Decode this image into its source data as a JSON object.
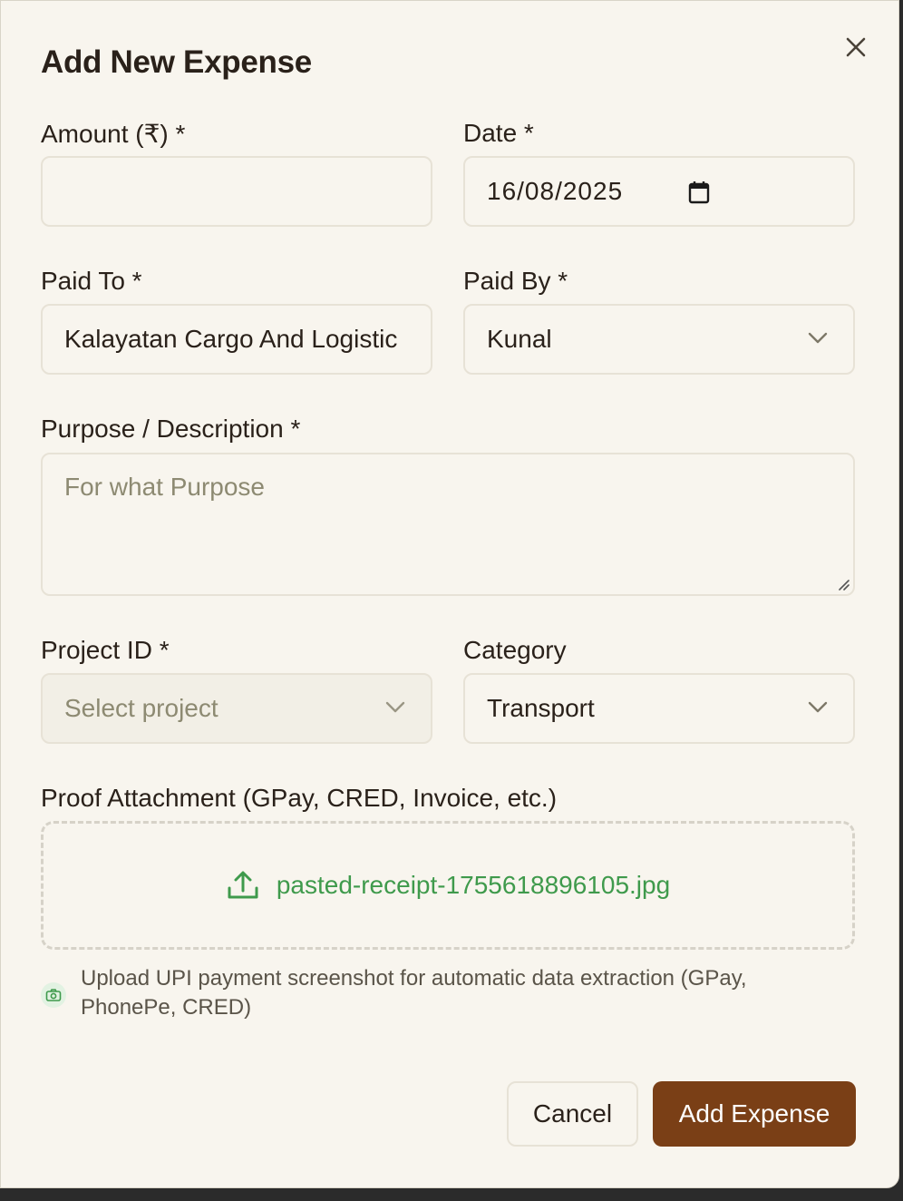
{
  "dialog": {
    "title": "Add New Expense"
  },
  "fields": {
    "amount": {
      "label": "Amount (₹) *",
      "value": ""
    },
    "date": {
      "label": "Date *",
      "value": "16/08/2025"
    },
    "paid_to": {
      "label": "Paid To *",
      "value": "Kalayatan Cargo And Logistic"
    },
    "paid_by": {
      "label": "Paid By *",
      "value": "Kunal"
    },
    "purpose": {
      "label": "Purpose / Description *",
      "placeholder": "For what Purpose"
    },
    "project_id": {
      "label": "Project ID *",
      "placeholder": "Select project"
    },
    "category": {
      "label": "Category",
      "value": "Transport"
    }
  },
  "attachment": {
    "label": "Proof Attachment (GPay, CRED, Invoice, etc.)",
    "filename": "pasted-receipt-1755618896105.jpg",
    "hint": "Upload UPI payment screenshot for automatic data extraction (GPay, PhonePe, CRED)"
  },
  "actions": {
    "cancel_label": "Cancel",
    "submit_label": "Add Expense"
  },
  "colors": {
    "background": "#f8f5ee",
    "accent": "#7a3f16",
    "file_green": "#3f9a4c"
  },
  "icons": {
    "close": "close-icon",
    "date": "calendar-icon",
    "select": "chevron-down-icon",
    "upload": "upload-icon",
    "hint": "camera-icon"
  }
}
